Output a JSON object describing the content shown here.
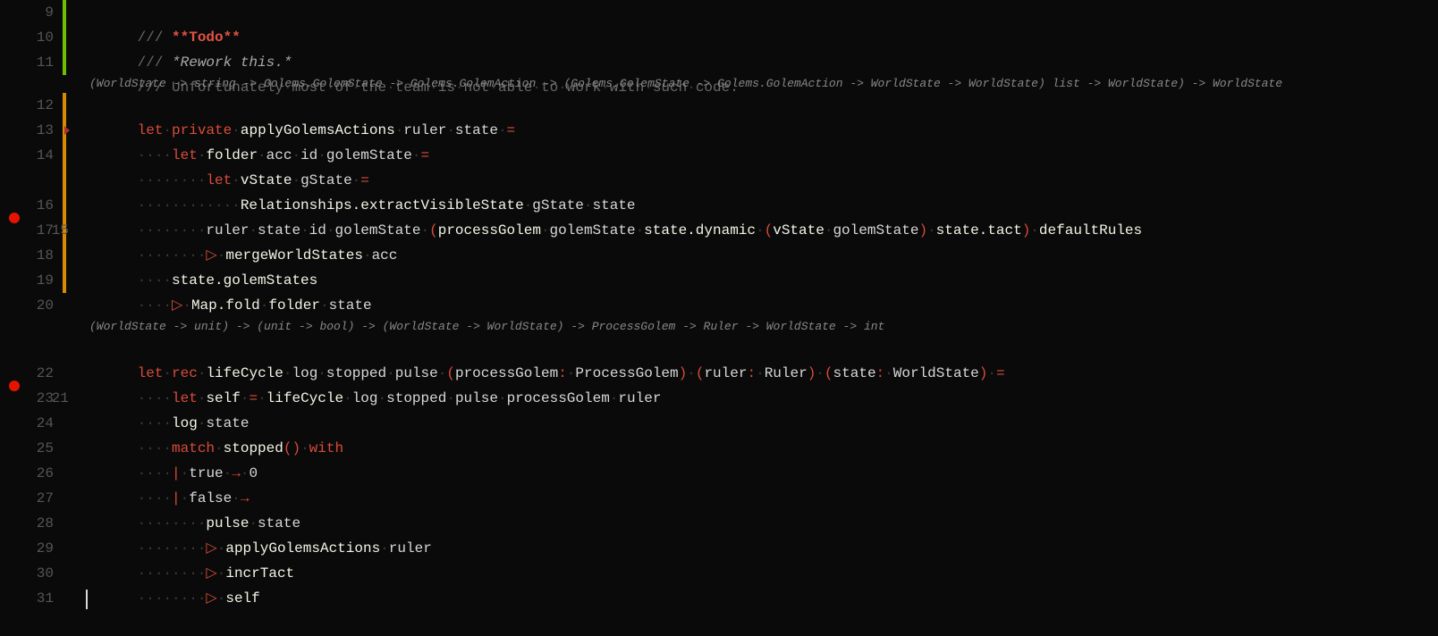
{
  "lineNumbers": {
    "l9": "9",
    "l10": "10",
    "l11": "11",
    "l12": "12",
    "l13": "13",
    "l14": "14",
    "l15": "15",
    "l16": "16",
    "l17": "17",
    "l18": "18",
    "l19": "19",
    "l20": "20",
    "l21": "21",
    "l22": "22",
    "l23": "23",
    "l24": "24",
    "l25": "25",
    "l26": "26",
    "l27": "27",
    "l28": "28",
    "l29": "29",
    "l30": "30",
    "l31": "31"
  },
  "comments": {
    "slashes": "/// ",
    "todo": "**Todo**",
    "rework": "*Rework this.*",
    "unfort": "Unfortunately most of the team is not able to work with such code."
  },
  "codelens": {
    "sig1": "(WorldState -> string -> Golems.GolemState -> Golems.GolemAction -> (Golems.GolemState -> Golems.GolemAction -> WorldState -> WorldState) list -> WorldState) -> WorldState",
    "sig2": "(WorldState -> unit) -> (unit -> bool) -> (WorldState -> WorldState) -> ProcessGolem -> Ruler -> WorldState -> int"
  },
  "kw": {
    "let": "let",
    "private": "private",
    "rec": "rec",
    "match": "match",
    "with": "with"
  },
  "tok": {
    "applyGolemsActions": "applyGolemsActions",
    "ruler": "ruler",
    "state": "state",
    "eq": "=",
    "folder": "folder",
    "acc": "acc",
    "id": "id",
    "golemState": "golemState",
    "vState": "vState",
    "gState": "gState",
    "Relationships": "Relationships.extractVisibleState",
    "processGolem": "processGolem",
    "stateDynamic": "state.dynamic",
    "stateTact": "state.tact",
    "defaultRules": "defaultRules",
    "mergeWorldStates": "mergeWorldStates",
    "stateGolemStates": "state.golemStates",
    "MapFold": "Map.fold",
    "pipeGlyph": "▷",
    "lifeCycle": "lifeCycle",
    "log": "log",
    "stopped": "stopped",
    "pulse": "pulse",
    "processGolemParam": "processGolem",
    "ProcessGolem": "ProcessGolem",
    "Ruler": "Ruler",
    "WorldState": "WorldState",
    "self": "self",
    "stoppedCall": "stopped",
    "parenUnit": "()",
    "bar": "|",
    "true": "true",
    "false": "false",
    "arrow": "→",
    "zero": "0",
    "incrTact": "incrTact",
    "colon": ":",
    "lp": "(",
    "rp": ")"
  },
  "ws": {
    "dots4": "····",
    "dots8": "········",
    "dots12": "············",
    "dots16": "················"
  }
}
